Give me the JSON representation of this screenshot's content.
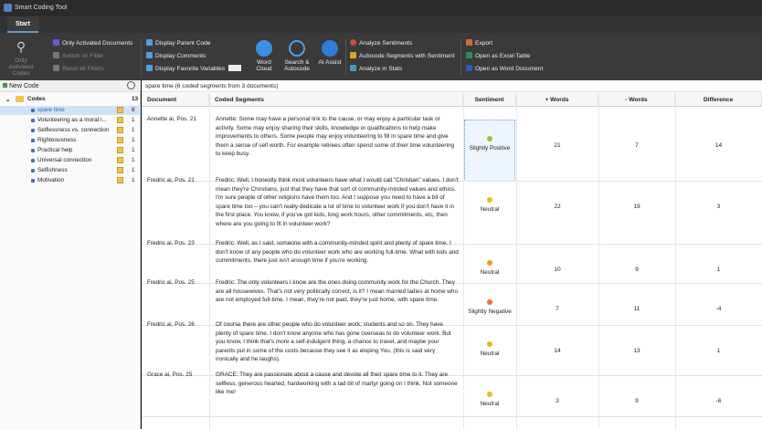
{
  "app": {
    "title": "Smart Coding Tool"
  },
  "tabs": [
    "Start"
  ],
  "ribbon": {
    "only_activated_codes": "Only Activated Codes",
    "only_activated_documents": "Only Activated Documents",
    "switch_on_filter": "Switch on Filter",
    "reset_all_filters": "Reset all Filters",
    "display_parent_code": "Display Parent Code",
    "display_comments": "Display Comments",
    "display_favorite_variables": "Display Favorite Variables",
    "word_cloud": "Word Cloud",
    "search_autocode": "Search & Autocode",
    "ai_assist": "AI Assist",
    "analyze_sentiments": "Analyze Sentiments",
    "autocode_segments": "Autocode Segments with Sentiment",
    "analyze_in_stats": "Analyze in Stats",
    "export": "Export",
    "open_excel": "Open as Excel Table",
    "open_word": "Open as Word Document"
  },
  "codes_panel": {
    "new_code": "New Code",
    "root": {
      "label": "Codes",
      "count": "13"
    },
    "items": [
      {
        "label": "spare time",
        "count": "6",
        "selected": true
      },
      {
        "label": "Volunteering as a moral i...",
        "count": "1"
      },
      {
        "label": "Selflessness vs. connection",
        "count": "1"
      },
      {
        "label": "Righteousness",
        "count": "1"
      },
      {
        "label": "Practical help",
        "count": "1"
      },
      {
        "label": "Universal connection",
        "count": "1"
      },
      {
        "label": "Selfishness",
        "count": "1"
      },
      {
        "label": "Motivation",
        "count": "1"
      }
    ]
  },
  "main": {
    "header": "spare time (6 coded segments from 3 documents)",
    "columns": {
      "document": "Document",
      "segment": "Coded Segments",
      "sentiment": "Sentiment",
      "pos": "+ Words",
      "neg": "- Words",
      "diff": "Difference"
    },
    "rows": [
      {
        "document": "Annette ai, Pos. 21",
        "segment": "Annette: Some may have a personal link to the cause, or may enjoy a particular task or activity. Some may enjoy sharing their skills, knowledge or qualifications to help make improvements to others. Some people may enjoy volunteering to fill in spare time and give them a sense of self worth. For example retirees often spend some of their time volunteering to keep busy.",
        "sentiment": "Slightly Positive",
        "color": "#8cc63f",
        "pos": "21",
        "neg": "7",
        "diff": "14"
      },
      {
        "document": "Fredric ai, Pos. 21",
        "segment": "Fredric: Well, I honestly think most volunteers have what I would call \"Christian\" values. I don't mean they're Christians, just that they have that sort of community-minded values and ethics. I'm sure people of other religions have them too. And I suppose you need to have a bit of spare time too – you can't really dedicate a lot of time to volunteer work if you don't have it in the first place. You know, if you've got kids, long work hours, other commitments, etc, then where are you going to fit in volunteer work?",
        "sentiment": "Neutral",
        "color": "#e6c21a",
        "pos": "22",
        "neg": "19",
        "diff": "3"
      },
      {
        "document": "Fredric ai, Pos. 23",
        "segment": "Fredric: Well, as I said, someone with a community-minded spirit and plenty of spare time. I don't know of any people who do volunteer work who are working full-time. What with kids and commitments, there just isn't enough time if you're working.",
        "sentiment": "Neutral",
        "color": "#e6a21a",
        "pos": "10",
        "neg": "9",
        "diff": "1"
      },
      {
        "document": "Fredric ai, Pos. 25",
        "segment": "Fredric: The only volunteers I know are the ones doing community work for the Church. They are all housewives. That's not very politically correct, is it? I mean married ladies at home who are not employed full-time. I mean, they're not paid, they're just home, with spare time.",
        "sentiment": "Slightly Negative",
        "color": "#e8742a",
        "pos": "7",
        "neg": "11",
        "diff": "-4"
      },
      {
        "document": "Fredric ai, Pos. 26",
        "segment": "Of course there are other people who do volunteer work; students and so on. They have plenty of spare time. I don't know anyone who has gone overseas to do volunteer work. But you know, I think that's more a self-indulgent thing, a chance to travel, and maybe your parents put in some of the costs because they see it as eloping You. (this is said very ironically and he laughs).",
        "sentiment": "Neutral",
        "color": "#e6b21a",
        "pos": "14",
        "neg": "13",
        "diff": "1"
      },
      {
        "document": "Grace ai, Pos. 25",
        "segment": "GRACE: They are passionate about a cause and devote all their spare time to it. They are selfless, generous hearted, hardworking with a tad bit of martyr going on I think. Not someone like me!",
        "sentiment": "Neutral",
        "color": "#e6c21a",
        "pos": "3",
        "neg": "9",
        "diff": "-6"
      }
    ]
  }
}
